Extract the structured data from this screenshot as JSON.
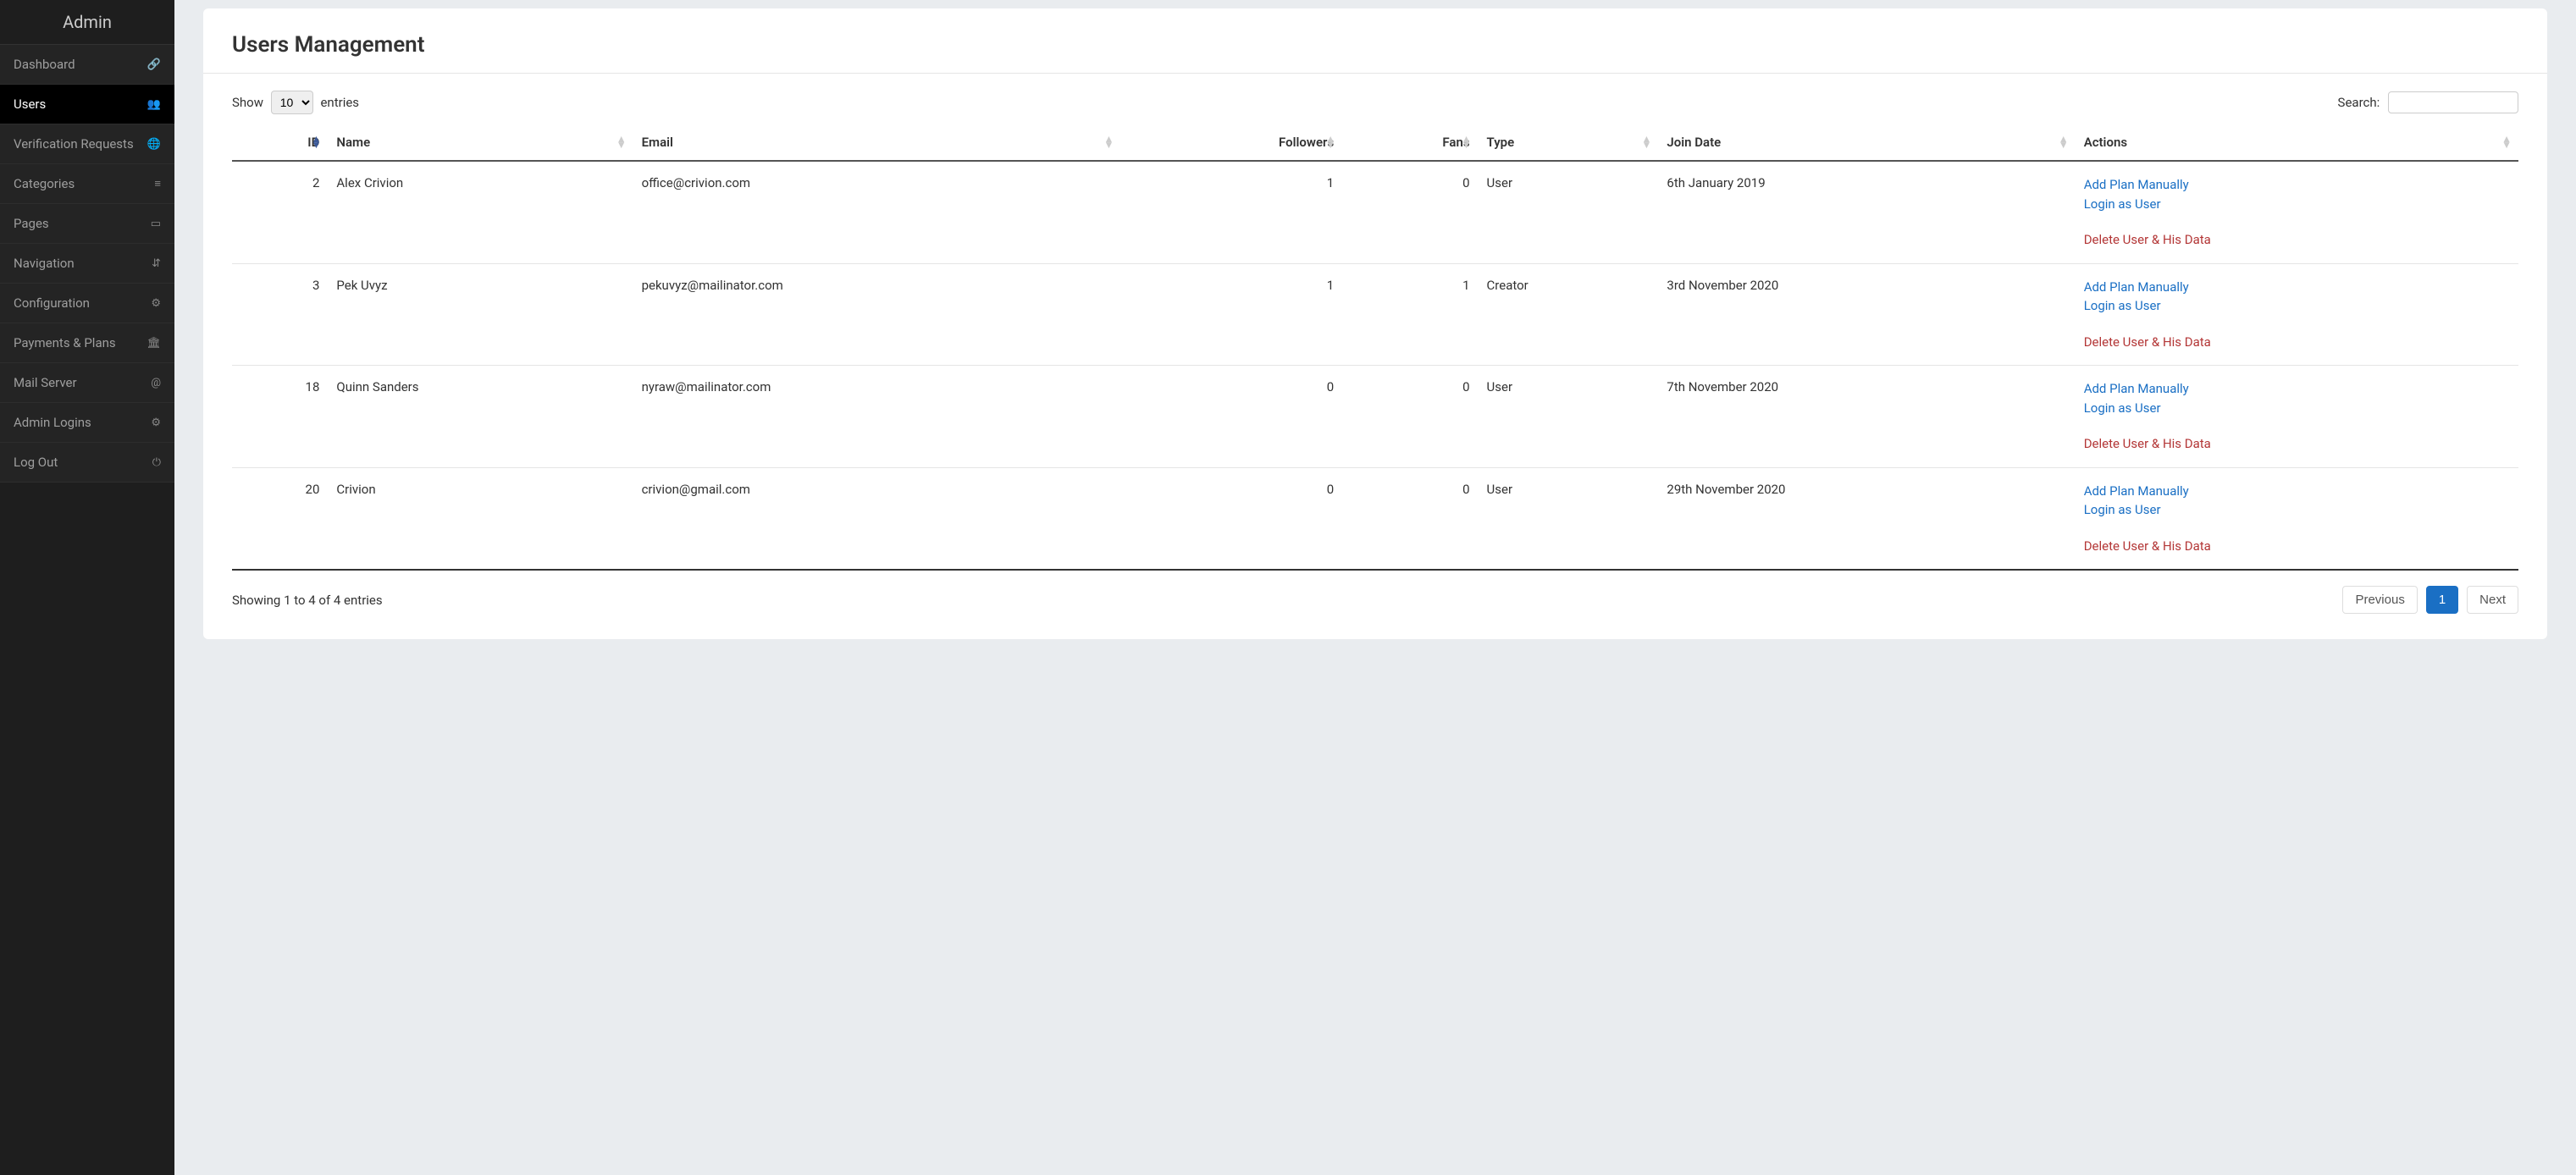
{
  "sidebar": {
    "title": "Admin",
    "items": [
      {
        "label": "Dashboard",
        "icon": "link-icon"
      },
      {
        "label": "Users",
        "icon": "users-icon",
        "active": true
      },
      {
        "label": "Verification Requests",
        "icon": "globe-icon"
      },
      {
        "label": "Categories",
        "icon": "bars-icon"
      },
      {
        "label": "Pages",
        "icon": "file-icon"
      },
      {
        "label": "Navigation",
        "icon": "sort-icon"
      },
      {
        "label": "Configuration",
        "icon": "gear-icon"
      },
      {
        "label": "Payments & Plans",
        "icon": "bank-icon"
      },
      {
        "label": "Mail Server",
        "icon": "at-icon"
      },
      {
        "label": "Admin Logins",
        "icon": "gear-icon"
      },
      {
        "label": "Log Out",
        "icon": "power-icon"
      }
    ]
  },
  "page": {
    "title": "Users Management"
  },
  "table_controls": {
    "show_label": "Show",
    "entries_label": "entries",
    "length_value": "10",
    "search_label": "Search:",
    "search_value": ""
  },
  "table": {
    "columns": [
      {
        "label": "ID",
        "align": "right",
        "sorted": "asc"
      },
      {
        "label": "Name"
      },
      {
        "label": "Email"
      },
      {
        "label": "Followers",
        "align": "right"
      },
      {
        "label": "Fans",
        "align": "right"
      },
      {
        "label": "Type"
      },
      {
        "label": "Join Date"
      },
      {
        "label": "Actions"
      }
    ],
    "rows": [
      {
        "id": "2",
        "name": "Alex Crivion",
        "email": "office@crivion.com",
        "followers": "1",
        "fans": "0",
        "type": "User",
        "join_date": "6th January 2019"
      },
      {
        "id": "3",
        "name": "Pek Uvyz",
        "email": "pekuvyz@mailinator.com",
        "followers": "1",
        "fans": "1",
        "type": "Creator",
        "join_date": "3rd November 2020"
      },
      {
        "id": "18",
        "name": "Quinn Sanders",
        "email": "nyraw@mailinator.com",
        "followers": "0",
        "fans": "0",
        "type": "User",
        "join_date": "7th November 2020"
      },
      {
        "id": "20",
        "name": "Crivion",
        "email": "crivion@gmail.com",
        "followers": "0",
        "fans": "0",
        "type": "User",
        "join_date": "29th November 2020"
      }
    ],
    "action_labels": {
      "add_plan": "Add Plan Manually",
      "login_as": "Login as User",
      "delete": "Delete User & His Data"
    }
  },
  "footer": {
    "info": "Showing 1 to 4 of 4 entries",
    "previous": "Previous",
    "next": "Next",
    "current_page": "1"
  }
}
